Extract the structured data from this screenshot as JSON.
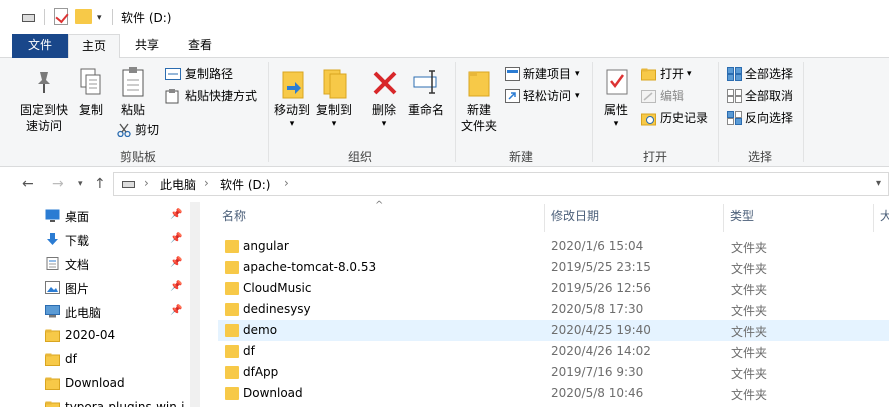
{
  "title": "软件 (D:)",
  "tabs": [
    "文件",
    "主页",
    "共享",
    "查看"
  ],
  "ribbon": {
    "clipboard": {
      "pin_quick": "固定到快\n速访问",
      "copy": "复制",
      "paste": "粘贴",
      "copy_path": "复制路径",
      "paste_shortcut": "粘贴快捷方式",
      "cut": "剪切",
      "label": "剪贴板"
    },
    "organize": {
      "move_to": "移动到",
      "copy_to": "复制到",
      "delete": "删除",
      "rename": "重命名",
      "label": "组织"
    },
    "new": {
      "new_folder": "新建\n文件夹",
      "new_item": "新建项目",
      "easy_access": "轻松访问",
      "label": "新建"
    },
    "open": {
      "properties": "属性",
      "open": "打开",
      "edit": "编辑",
      "history": "历史记录",
      "label": "打开"
    },
    "select": {
      "select_all": "全部选择",
      "select_none": "全部取消",
      "invert": "反向选择",
      "label": "选择"
    }
  },
  "address": {
    "parts": [
      "此电脑",
      "软件 (D:)"
    ]
  },
  "nav_pane": [
    {
      "label": "桌面",
      "icon": "desktop-icon",
      "pinned": true
    },
    {
      "label": "下载",
      "icon": "download-icon",
      "pinned": true
    },
    {
      "label": "文档",
      "icon": "document-icon",
      "pinned": true
    },
    {
      "label": "图片",
      "icon": "picture-icon",
      "pinned": true
    },
    {
      "label": "此电脑",
      "icon": "computer-icon",
      "pinned": true
    },
    {
      "label": "2020-04",
      "icon": "folder-icon",
      "pinned": false
    },
    {
      "label": "df",
      "icon": "folder-icon",
      "pinned": false
    },
    {
      "label": "Download",
      "icon": "folder-icon",
      "pinned": false
    },
    {
      "label": "typora-plugins-win-i",
      "icon": "folder-icon",
      "pinned": false
    }
  ],
  "columns": {
    "name": "名称",
    "date": "修改日期",
    "type": "类型",
    "size": "大"
  },
  "files": [
    {
      "name": "angular",
      "date": "2020/1/6 15:04",
      "type": "文件夹"
    },
    {
      "name": "apache-tomcat-8.0.53",
      "date": "2019/5/25 23:15",
      "type": "文件夹"
    },
    {
      "name": "CloudMusic",
      "date": "2019/5/26 12:56",
      "type": "文件夹"
    },
    {
      "name": "dedinesysy",
      "date": "2020/5/8 17:30",
      "type": "文件夹"
    },
    {
      "name": "demo",
      "date": "2020/4/25 19:40",
      "type": "文件夹"
    },
    {
      "name": "df",
      "date": "2020/4/26 14:02",
      "type": "文件夹"
    },
    {
      "name": "dfApp",
      "date": "2019/7/16 9:30",
      "type": "文件夹"
    },
    {
      "name": "Download",
      "date": "2020/5/8 10:46",
      "type": "文件夹"
    }
  ],
  "selected_file_index": 4
}
